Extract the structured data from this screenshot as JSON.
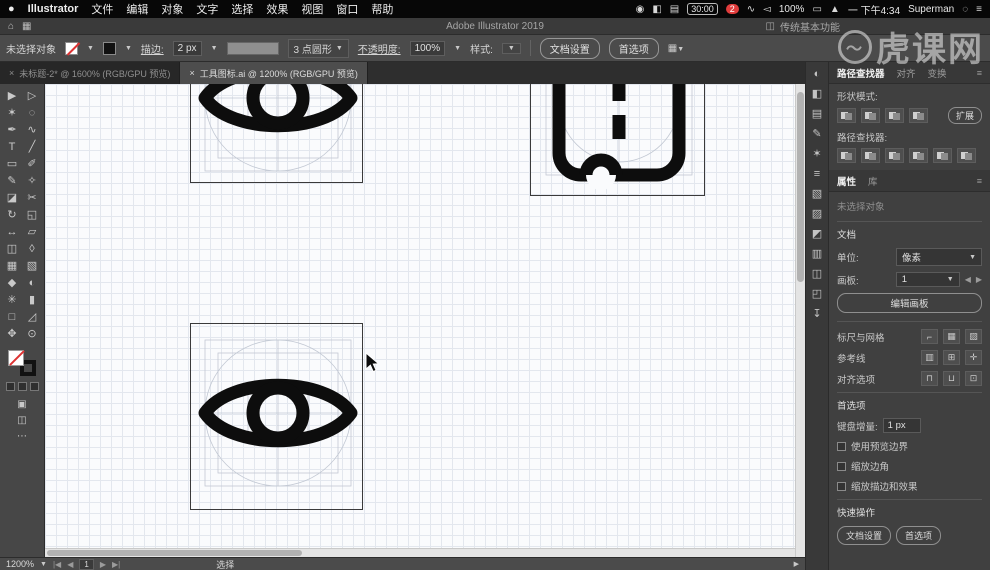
{
  "watermark": {
    "text": "虎课网"
  },
  "menubar": {
    "apple": "●",
    "app": "Illustrator",
    "items": [
      "文件",
      "编辑",
      "对象",
      "文字",
      "选择",
      "效果",
      "视图",
      "窗口",
      "帮助"
    ],
    "status": {
      "timer": "30:00",
      "badge": "2",
      "battery": "100%",
      "datetime": "一 下午4:34",
      "user": "Superman"
    }
  },
  "titlebar": {
    "title": "Adobe Illustrator 2019",
    "workspace": "传统基本功能"
  },
  "controlbar": {
    "selection_status": "未选择对象",
    "stroke_label": "描边:",
    "stroke_value": "2 px",
    "brush": "3 点圆形",
    "opacity_label": "不透明度:",
    "opacity_value": "100%",
    "style_label": "样式:",
    "document_setup": "文档设置",
    "preferences": "首选项"
  },
  "tabbar": {
    "tabs": [
      {
        "label": "未标题-2* @ 1600% (RGB/GPU 预览)"
      },
      {
        "label": "工具图标.ai @ 1200% (RGB/GPU 预览)"
      }
    ]
  },
  "toolbar": {
    "tools": [
      "selection",
      "direct-selection",
      "magic-wand",
      "lasso",
      "pen",
      "curvature",
      "type",
      "line-segment",
      "rectangle",
      "paintbrush",
      "pencil",
      "shaper",
      "eraser",
      "scissors",
      "rotate",
      "scale",
      "width",
      "free-transform",
      "shape-builder",
      "perspective-grid",
      "mesh",
      "gradient",
      "eyedropper",
      "blend",
      "symbol-sprayer",
      "column-graph",
      "artboard",
      "slice",
      "hand",
      "zoom"
    ]
  },
  "panel_strip": {
    "icons": [
      "color",
      "color-guide",
      "swatches",
      "brushes",
      "symbols",
      "stroke",
      "gradient",
      "transparency",
      "appearance",
      "graphic-styles",
      "layers",
      "artboards",
      "asset-export"
    ]
  },
  "pathfinder_panel": {
    "tabs": [
      "路径查找器",
      "对齐",
      "变换"
    ],
    "shape_modes_label": "形状模式:",
    "expand": "扩展",
    "pathfinders_label": "路径查找器:"
  },
  "properties_panel": {
    "tabs": [
      "属性",
      "库"
    ],
    "selection_status": "未选择对象",
    "document": {
      "header": "文档",
      "units_label": "单位:",
      "units_value": "像素",
      "artboard_label": "画板:",
      "artboard_value": "1",
      "edit_artboards": "编辑画板",
      "rulers_grids": "标尺与网格",
      "guides": "参考线",
      "snap": "对齐选项"
    },
    "preferences": {
      "header": "首选项",
      "keyboard_increment_label": "键盘增量:",
      "keyboard_increment_value": "1 px",
      "options": [
        "使用预览边界",
        "缩放边角",
        "缩放描边和效果"
      ]
    },
    "quick_actions": {
      "header": "快速操作",
      "buttons": [
        "文档设置",
        "首选项"
      ]
    }
  },
  "statusbar": {
    "zoom": "1200%",
    "artboard_nav": "1",
    "tool": "选择"
  }
}
